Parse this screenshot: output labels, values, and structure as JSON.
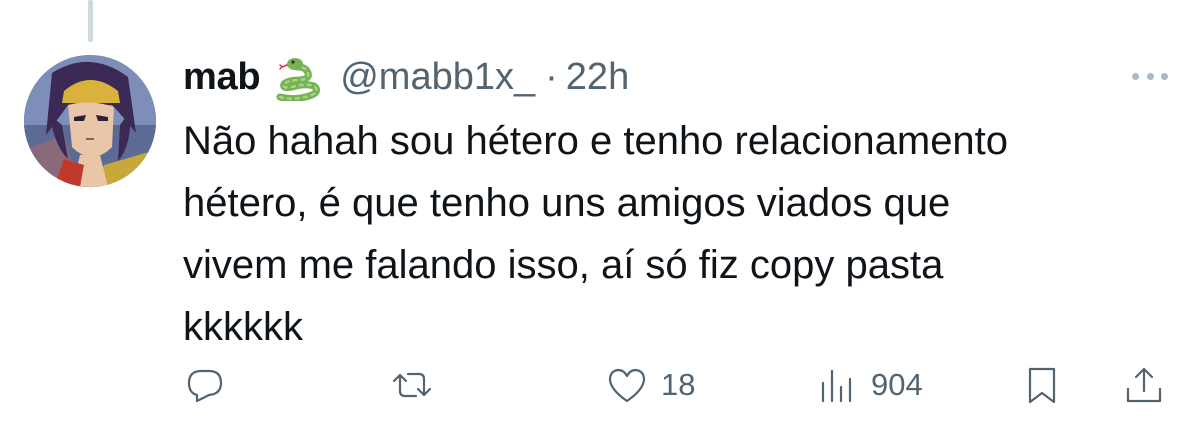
{
  "tweet": {
    "display_name": "mab",
    "emoji": "snake",
    "handle": "@mabb1x_",
    "separator": "·",
    "time": "22h",
    "text": "Não hahah sou hétero e tenho relacionamento\nhétero, é que tenho uns amigos viados que\nvivem me falando isso, aí só fiz copy pasta\nkkkkkk"
  },
  "actions": {
    "reply_icon": "speech-bubble-icon",
    "retweet_icon": "retweet-icon",
    "like_icon": "heart-icon",
    "like_count": "18",
    "views_icon": "bar-chart-icon",
    "views_count": "904",
    "bookmark_icon": "bookmark-icon",
    "share_icon": "share-icon"
  },
  "colors": {
    "text_primary": "#0f1419",
    "text_secondary": "#536471",
    "thread_line": "#cfd9de"
  }
}
